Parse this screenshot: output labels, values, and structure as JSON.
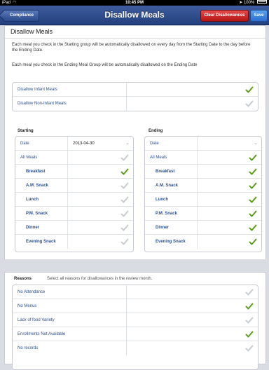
{
  "status_bar": {
    "carrier": "iPad",
    "time": "10:45 PM",
    "battery": "100%"
  },
  "navbar": {
    "back_label": "Compliance",
    "title": "Disallow Meals",
    "clear_label": "Clear Disallowances",
    "save_label": "Save"
  },
  "card": {
    "title": "Disallow Meals",
    "intro1": "Each meal you check in the Starting group will be automatically disallowed on every day from the Starting Date to the day before the Ending Date.",
    "intro2": "Each meal you check in the Ending Meal Group will be automatically disallowed on the Ending Date"
  },
  "top_rows": [
    {
      "label": "Disallow Infant Meals",
      "checked": true
    },
    {
      "label": "Disallow Non-Infant Meals",
      "checked": false
    }
  ],
  "starting": {
    "header": "Starting",
    "date_label": "Date",
    "date_value": "2013-04-30",
    "all_meals": {
      "label": "All Meals",
      "checked": false
    },
    "meals": [
      {
        "label": "Breakfast",
        "checked": true
      },
      {
        "label": "A.M. Snack",
        "checked": false
      },
      {
        "label": "Lunch",
        "checked": false
      },
      {
        "label": "P.M. Snack",
        "checked": false
      },
      {
        "label": "Dinner",
        "checked": false
      },
      {
        "label": "Evening Snack",
        "checked": false
      }
    ]
  },
  "ending": {
    "header": "Ending",
    "date_label": "Date",
    "date_value": "",
    "all_meals": {
      "label": "All Meals",
      "checked": true
    },
    "meals": [
      {
        "label": "Breakfast",
        "checked": true
      },
      {
        "label": "A.M. Snack",
        "checked": true
      },
      {
        "label": "Lunch",
        "checked": true
      },
      {
        "label": "P.M. Snack",
        "checked": true
      },
      {
        "label": "Dinner",
        "checked": true
      },
      {
        "label": "Evening Snack",
        "checked": true
      }
    ]
  },
  "reasons": {
    "header": "Reasons",
    "subtitle": "Select all reasons for disallowances in the review month.",
    "items": [
      {
        "label": "No Attendance",
        "checked": false
      },
      {
        "label": "No Menus",
        "checked": true
      },
      {
        "label": "Lack of food Variety",
        "checked": false
      },
      {
        "label": "Enrollments Not Available",
        "checked": true
      },
      {
        "label": "No records",
        "checked": false
      }
    ]
  },
  "colors": {
    "checked": "#5e9e1d",
    "unchecked": "#c7ccd2",
    "label": "#2a4f8f",
    "nav_bar": "#2f4c8c",
    "clear_button": "#c81e1e",
    "save_button": "#3b84e0"
  }
}
